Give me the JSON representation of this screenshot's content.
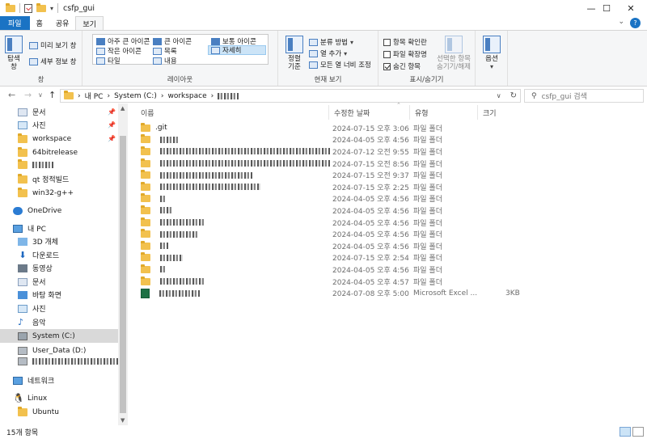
{
  "window": {
    "title": "csfp_gui"
  },
  "tabs": [
    {
      "label": "파일"
    },
    {
      "label": "홈"
    },
    {
      "label": "공유"
    },
    {
      "label": "보기"
    }
  ],
  "ribbon": {
    "pane": {
      "nav_pane": "탐색\n창",
      "preview": "미리 보기 창",
      "details": "세부 정보 창",
      "group": "창"
    },
    "layout": {
      "items": [
        "아주 큰 아이콘",
        "큰 아이콘",
        "보통 아이콘",
        "작은 아이콘",
        "목록",
        "자세히",
        "타일",
        "내용"
      ],
      "group": "레이아웃"
    },
    "current_view": {
      "sort": "정렬\n기준",
      "group_by": "분류 방법",
      "add_col": "열 추가",
      "fit_cols": "모든 열 너비 조정",
      "group": "현재 보기"
    },
    "show_hide": {
      "checkbox_ext": "항목 확인란",
      "file_ext": "파일 확장명",
      "hidden": "숨긴 항목",
      "hide_sel": "선택한 항목\n숨기기/해제",
      "group": "표시/숨기기"
    },
    "options": {
      "label": "옵션"
    }
  },
  "address": {
    "crumbs": [
      "내 PC",
      "System (C:)",
      "workspace"
    ],
    "search_placeholder": "csfp_gui 검색"
  },
  "sidebar": {
    "quick": [
      {
        "label": "문서",
        "pinned": true
      },
      {
        "label": "사진",
        "pinned": true
      },
      {
        "label": "workspace",
        "pinned": true
      },
      {
        "label": "64bitrelease",
        "pinned": false
      },
      {
        "label": "",
        "pinned": false
      },
      {
        "label": "qt 정적빌드",
        "pinned": false
      },
      {
        "label": "win32-g++",
        "pinned": false
      }
    ],
    "onedrive": "OneDrive",
    "thispc": "내 PC",
    "pc_items": [
      "3D 개체",
      "다운로드",
      "동영상",
      "문서",
      "바탕 화면",
      "사진",
      "음악",
      "System (C:)",
      "User_Data (D:)"
    ],
    "network": "네트워크",
    "linux": [
      "Linux",
      "Ubuntu"
    ]
  },
  "columns": {
    "name": "이름",
    "date": "수정한 날짜",
    "type": "유형",
    "size": "크기"
  },
  "files": [
    {
      "name": ".git",
      "date": "2024-07-15 오후 3:06",
      "type": "파일 폴더",
      "size": "",
      "kind": "folder"
    },
    {
      "name": "",
      "date": "2024-04-05 오후 4:56",
      "type": "파일 폴더",
      "size": "",
      "kind": "folder"
    },
    {
      "name": "",
      "date": "2024-07-12 오전 9:55",
      "type": "파일 폴더",
      "size": "",
      "kind": "folder"
    },
    {
      "name": "",
      "date": "2024-07-15 오전 8:56",
      "type": "파일 폴더",
      "size": "",
      "kind": "folder"
    },
    {
      "name": "",
      "date": "2024-07-15 오전 9:37",
      "type": "파일 폴더",
      "size": "",
      "kind": "folder"
    },
    {
      "name": "",
      "date": "2024-07-15 오후 2:25",
      "type": "파일 폴더",
      "size": "",
      "kind": "folder"
    },
    {
      "name": "",
      "date": "2024-04-05 오후 4:56",
      "type": "파일 폴더",
      "size": "",
      "kind": "folder"
    },
    {
      "name": "",
      "date": "2024-04-05 오후 4:56",
      "type": "파일 폴더",
      "size": "",
      "kind": "folder"
    },
    {
      "name": "",
      "date": "2024-04-05 오후 4:56",
      "type": "파일 폴더",
      "size": "",
      "kind": "folder"
    },
    {
      "name": "",
      "date": "2024-04-05 오후 4:56",
      "type": "파일 폴더",
      "size": "",
      "kind": "folder"
    },
    {
      "name": "",
      "date": "2024-04-05 오후 4:56",
      "type": "파일 폴더",
      "size": "",
      "kind": "folder"
    },
    {
      "name": "",
      "date": "2024-07-15 오후 2:54",
      "type": "파일 폴더",
      "size": "",
      "kind": "folder"
    },
    {
      "name": "",
      "date": "2024-04-05 오후 4:56",
      "type": "파일 폴더",
      "size": "",
      "kind": "folder"
    },
    {
      "name": "",
      "date": "2024-04-05 오후 4:57",
      "type": "파일 폴더",
      "size": "",
      "kind": "folder"
    },
    {
      "name": "",
      "date": "2024-07-08 오후 5:00",
      "type": "Microsoft Excel ...",
      "size": "3KB",
      "kind": "excel"
    }
  ],
  "status": {
    "count": "15개 항목"
  }
}
